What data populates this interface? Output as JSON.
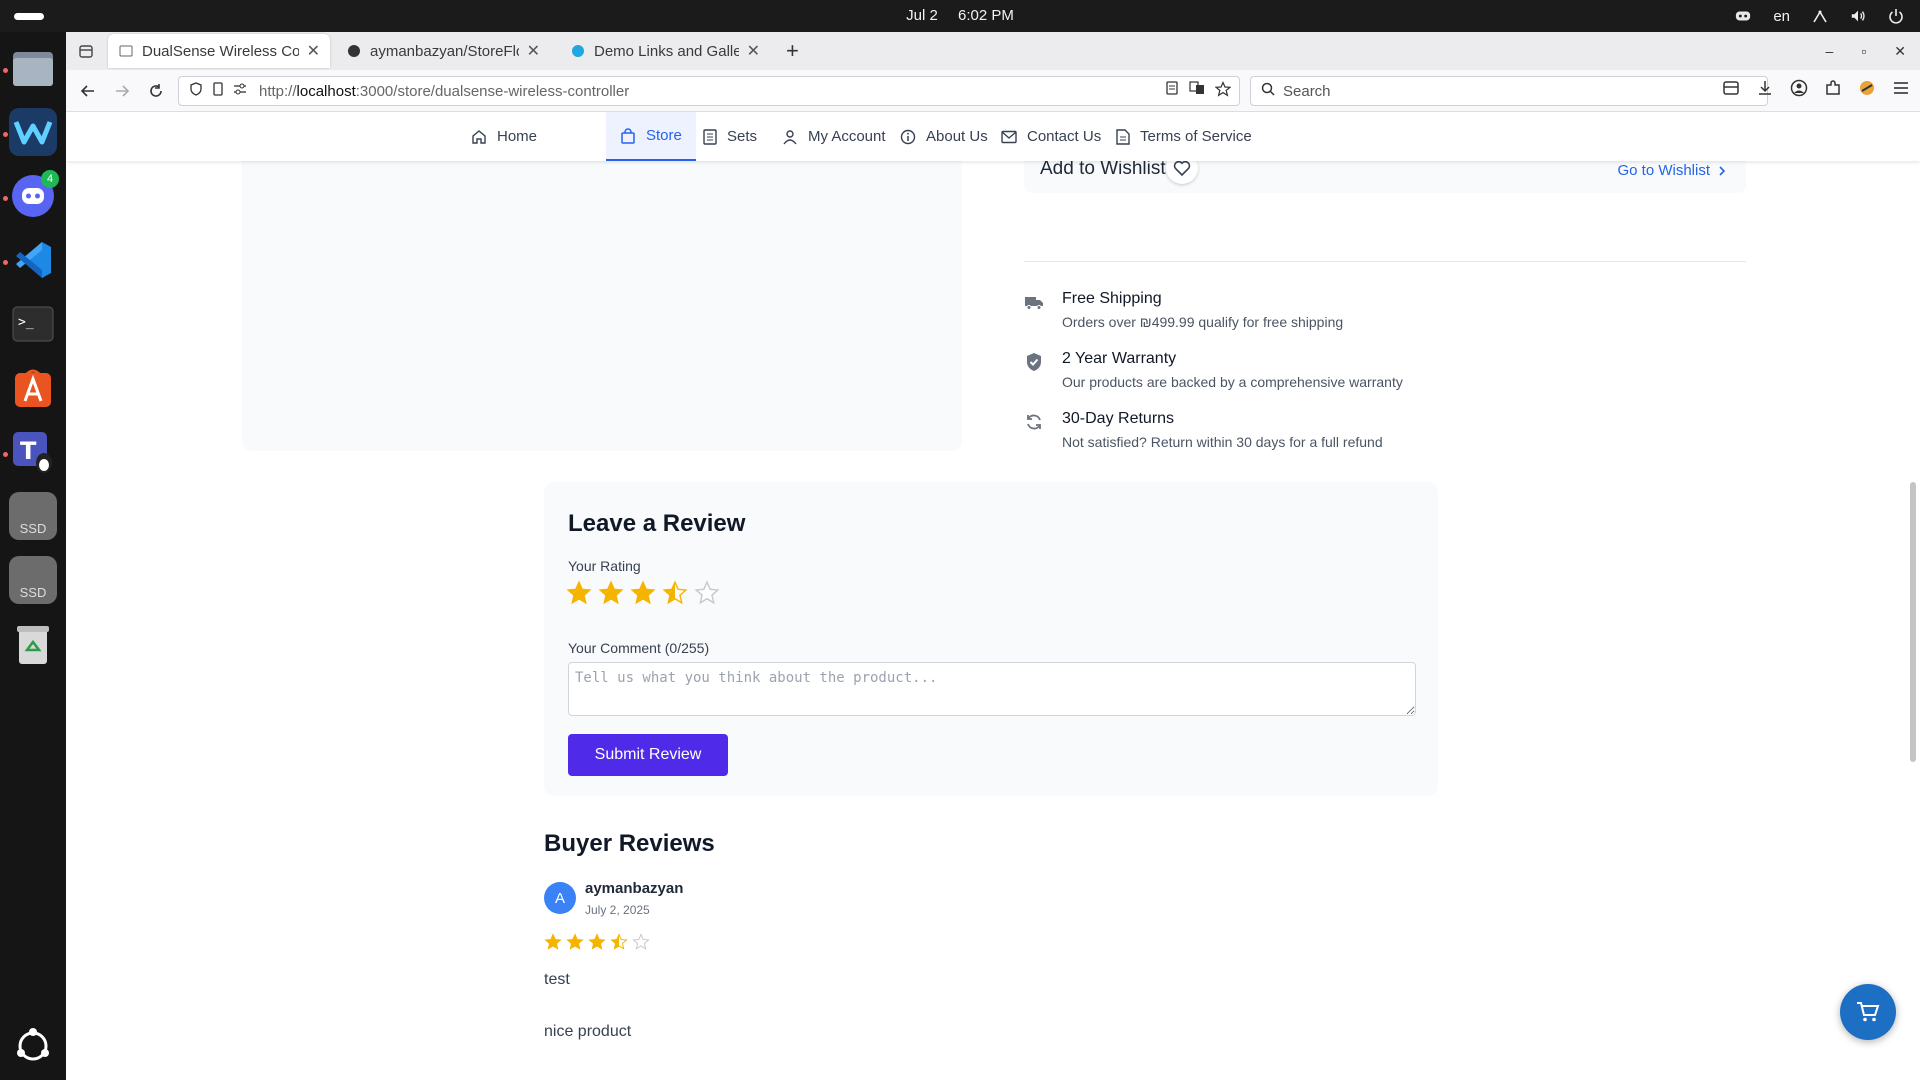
{
  "system": {
    "date": "Jul 2",
    "time": "6:02 PM",
    "language": "en"
  },
  "dock": {
    "discord_badge": "4",
    "ssd1": "SSD",
    "ssd2": "SSD"
  },
  "browser": {
    "tabs": [
      {
        "title": "DualSense Wireless Cont",
        "active": true
      },
      {
        "title": "aymanbazyan/StoreFlow",
        "active": false
      },
      {
        "title": "Demo Links and Gallery |",
        "active": false
      }
    ],
    "url_prefix": "http://",
    "url_host": "localhost",
    "url_rest": ":3000/store/dualsense-wireless-controller",
    "search_placeholder": "Search"
  },
  "site_nav": {
    "items": [
      "Home",
      "Store",
      "Sets",
      "My Account",
      "About Us",
      "Contact Us",
      "Terms of Service"
    ],
    "active": "Store"
  },
  "wishlist": {
    "label": "Add to Wishlist",
    "link": "Go to Wishlist"
  },
  "features": [
    {
      "title": "Free Shipping",
      "desc": "Orders over ₪499.99 qualify for free shipping",
      "icon": "truck-icon"
    },
    {
      "title": "2 Year Warranty",
      "desc": "Our products are backed by a comprehensive warranty",
      "icon": "shield-check-icon"
    },
    {
      "title": "30-Day Returns",
      "desc": "Not satisfied? Return within 30 days for a full refund",
      "icon": "refresh-icon"
    }
  ],
  "review_form": {
    "heading": "Leave a Review",
    "rating_label": "Your Rating",
    "rating_value": 3.5,
    "rating_max": 5,
    "comment_label": "Your Comment (0/255)",
    "comment_placeholder": "Tell us what you think about the product...",
    "submit_label": "Submit Review"
  },
  "buyer_reviews": {
    "heading": "Buyer Reviews",
    "reviews": [
      {
        "initial": "A",
        "name": "aymanbazyan",
        "date": "July 2, 2025",
        "rating": 3.5,
        "text1": "test",
        "text2": "nice product"
      }
    ]
  },
  "colors": {
    "accent": "#2563eb",
    "submit": "#4f2ae8",
    "star": "#f5b400",
    "cart": "#1d6fc4"
  }
}
